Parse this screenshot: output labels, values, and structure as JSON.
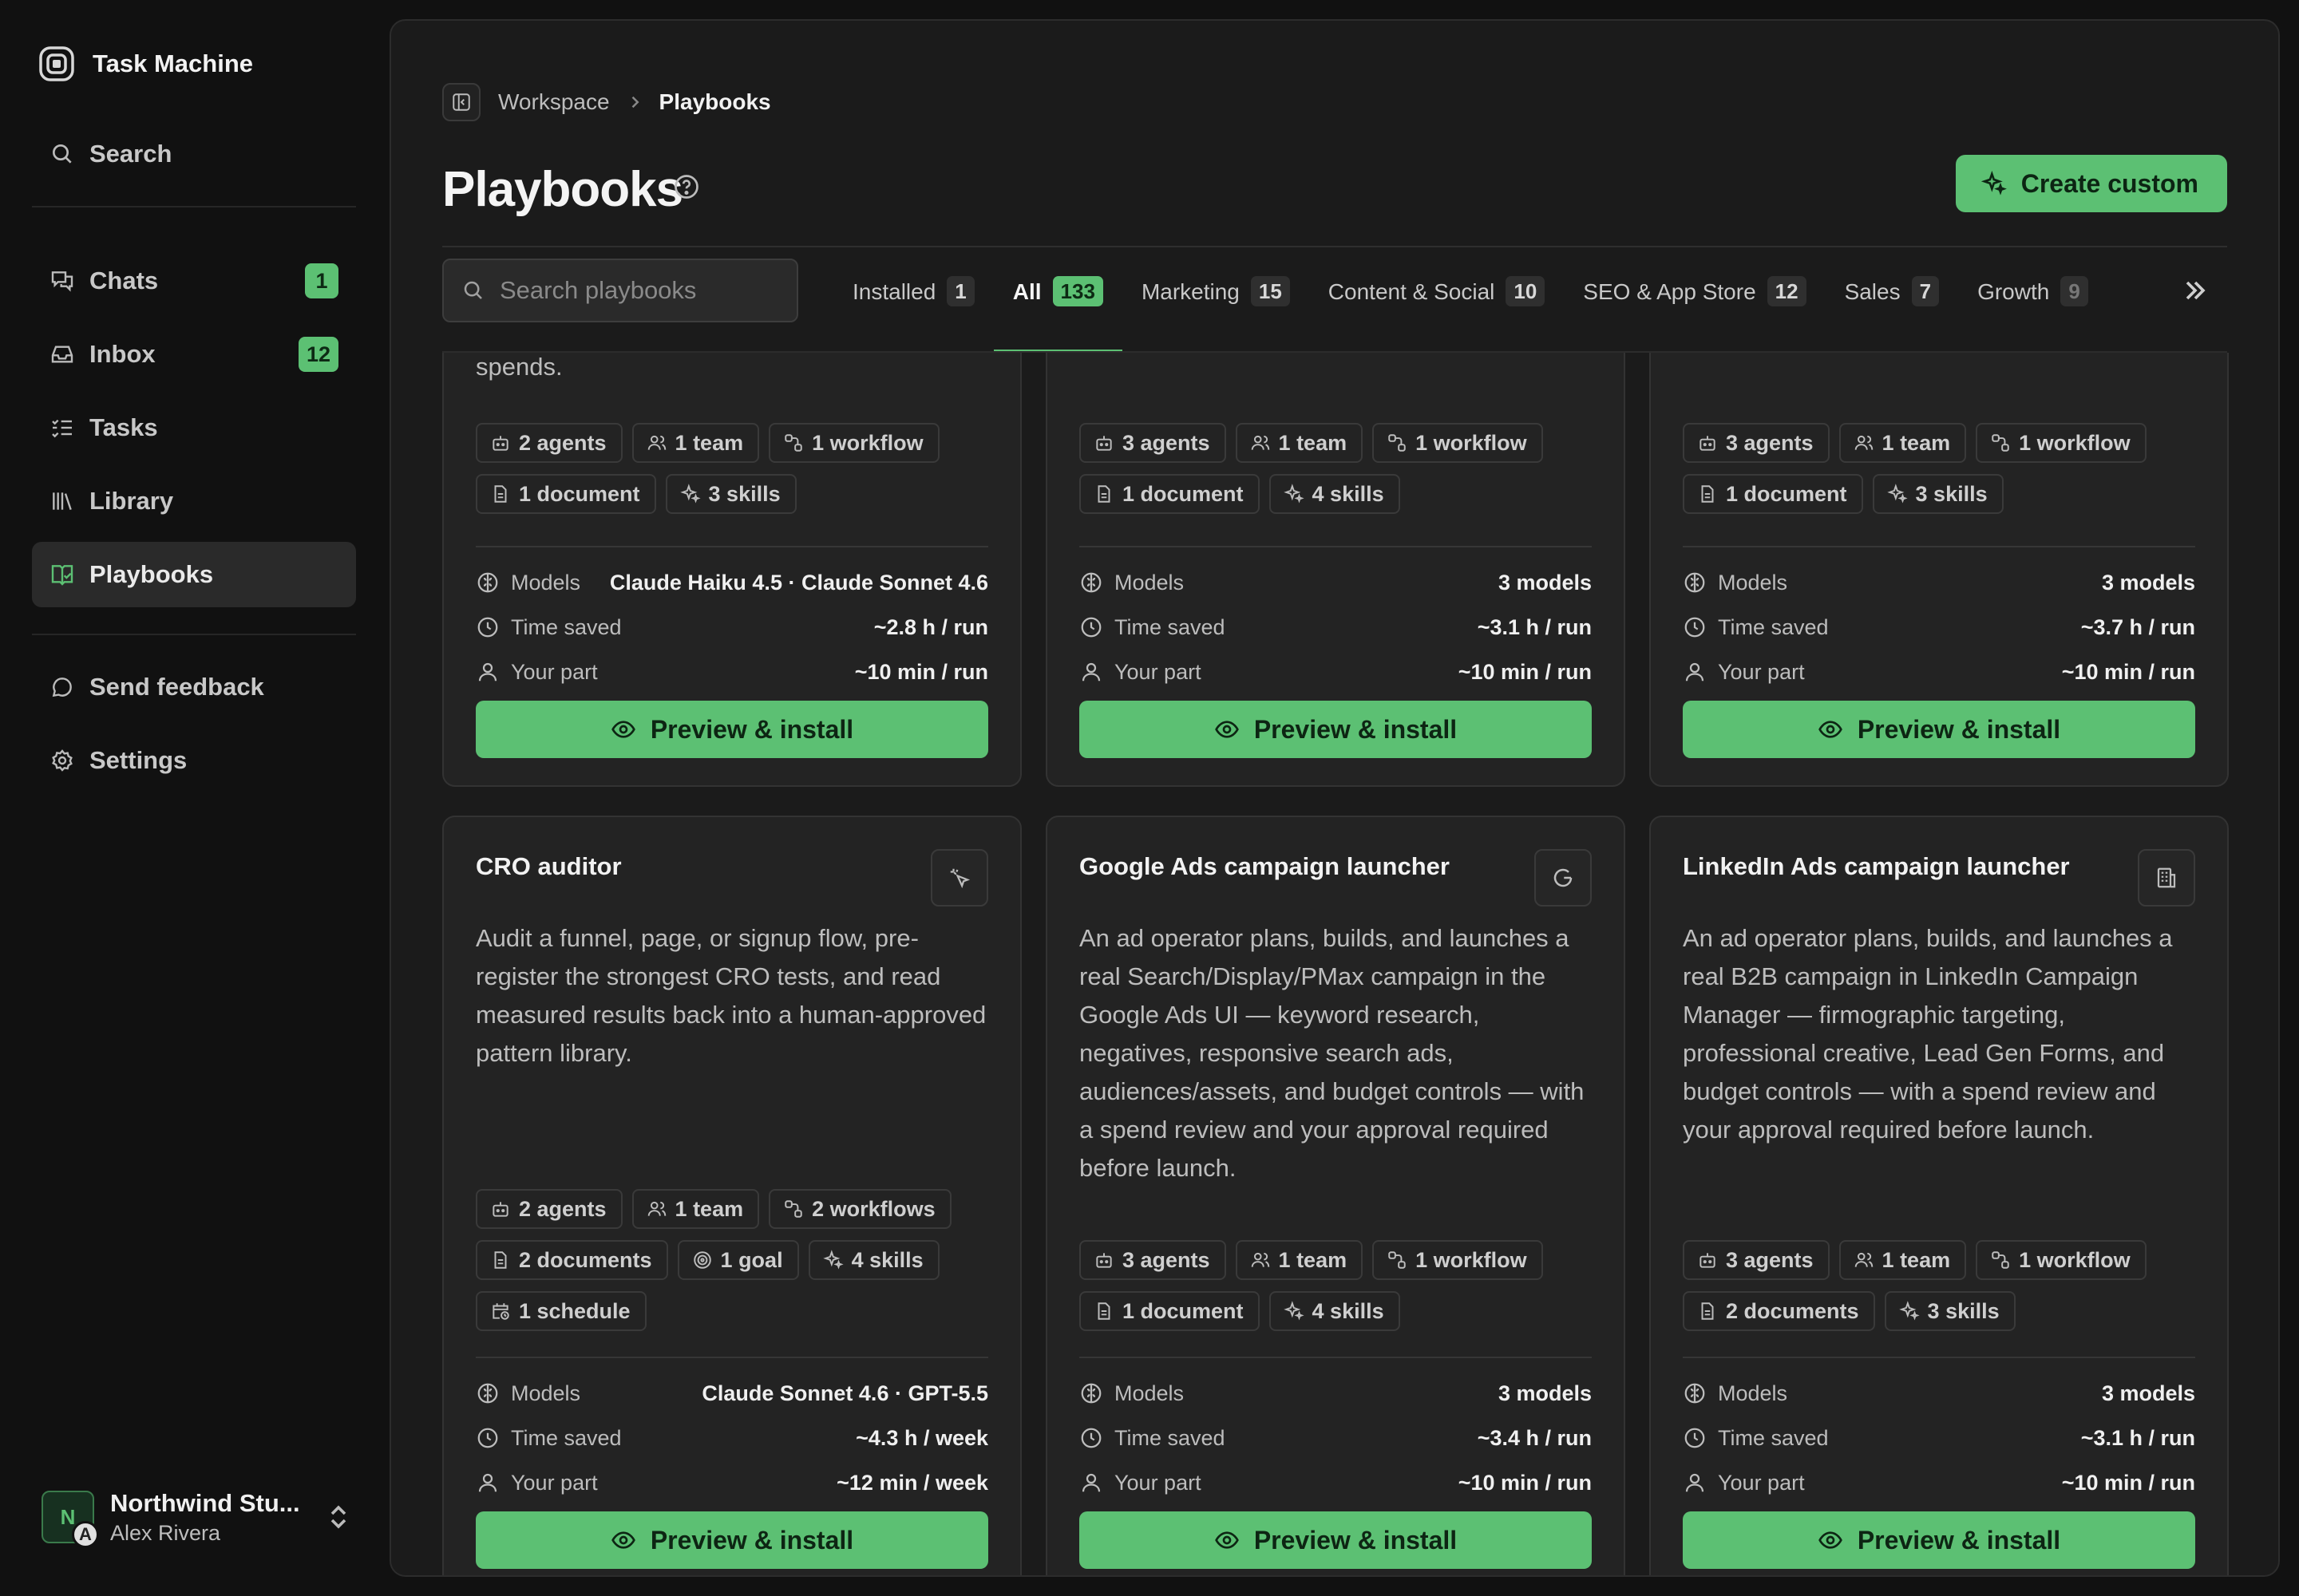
{
  "sidebar": {
    "brand": "Task Machine",
    "search": "Search",
    "items": [
      {
        "label": "Chats",
        "badge": "1"
      },
      {
        "label": "Inbox",
        "badge": "12"
      },
      {
        "label": "Tasks"
      },
      {
        "label": "Library"
      },
      {
        "label": "Playbooks"
      }
    ],
    "feedback": "Send feedback",
    "settings": "Settings",
    "workspace": {
      "initial": "N",
      "user_initial": "A",
      "name": "Northwind Stu...",
      "user": "Alex Rivera"
    }
  },
  "header": {
    "breadcrumb": {
      "parent": "Workspace",
      "current": "Playbooks"
    },
    "title": "Playbooks",
    "create_label": "Create custom"
  },
  "search": {
    "placeholder": "Search playbooks"
  },
  "tabs": [
    {
      "label": "Installed",
      "count": "1"
    },
    {
      "label": "All",
      "count": "133"
    },
    {
      "label": "Marketing",
      "count": "15"
    },
    {
      "label": "Content & Social",
      "count": "10"
    },
    {
      "label": "SEO & App Store",
      "count": "12"
    },
    {
      "label": "Sales",
      "count": "7"
    },
    {
      "label": "Growth",
      "count": "9"
    }
  ],
  "labels": {
    "models": "Models",
    "time_saved": "Time saved",
    "your_part": "Your part",
    "install": "Preview & install"
  },
  "cards_top": [
    {
      "desc_tail": "spends.",
      "chips": [
        "2 agents",
        "1 team",
        "1 workflow",
        "1 document",
        "3 skills"
      ],
      "models": "Claude Haiku 4.5 · Claude Sonnet 4.6",
      "time_saved": "~2.8 h / run",
      "your_part": "~10 min / run"
    },
    {
      "chips": [
        "3 agents",
        "1 team",
        "1 workflow",
        "1 document",
        "4 skills"
      ],
      "models": "3 models",
      "time_saved": "~3.1 h / run",
      "your_part": "~10 min / run"
    },
    {
      "chips": [
        "3 agents",
        "1 team",
        "1 workflow",
        "1 document",
        "3 skills"
      ],
      "models": "3 models",
      "time_saved": "~3.7 h / run",
      "your_part": "~10 min / run"
    }
  ],
  "cards_bottom": [
    {
      "title": "CRO auditor",
      "icon": "cursor-click-icon",
      "desc": "Audit a funnel, page, or signup flow, pre-register the strongest CRO tests, and read measured results back into a human-approved pattern library.",
      "chips": [
        "2 agents",
        "1 team",
        "2 workflows",
        "2 documents",
        "1 goal",
        "4 skills",
        "1 schedule"
      ],
      "models": "Claude Sonnet 4.6 · GPT-5.5",
      "time_saved": "~4.3 h / week",
      "your_part": "~12 min / week"
    },
    {
      "title": "Google Ads campaign launcher",
      "icon": "google-icon",
      "desc": "An ad operator plans, builds, and launches a real Search/Display/PMax campaign in the Google Ads UI — keyword research, negatives, responsive search ads, audiences/assets, and budget controls — with a spend review and your approval required before launch.",
      "chips": [
        "3 agents",
        "1 team",
        "1 workflow",
        "1 document",
        "4 skills"
      ],
      "models": "3 models",
      "time_saved": "~3.4 h / run",
      "your_part": "~10 min / run"
    },
    {
      "title": "LinkedIn Ads campaign launcher",
      "icon": "building-icon",
      "desc": "An ad operator plans, builds, and launches a real B2B campaign in LinkedIn Campaign Manager — firmographic targeting, professional creative, Lead Gen Forms, and budget controls — with a spend review and your approval required before launch.",
      "chips": [
        "3 agents",
        "1 team",
        "1 workflow",
        "2 documents",
        "3 skills"
      ],
      "models": "3 models",
      "time_saved": "~3.1 h / run",
      "your_part": "~10 min / run"
    }
  ],
  "colors": {
    "accent": "#5cc073",
    "background": "#111111",
    "panel": "#1b1b1b",
    "card": "#232323"
  }
}
